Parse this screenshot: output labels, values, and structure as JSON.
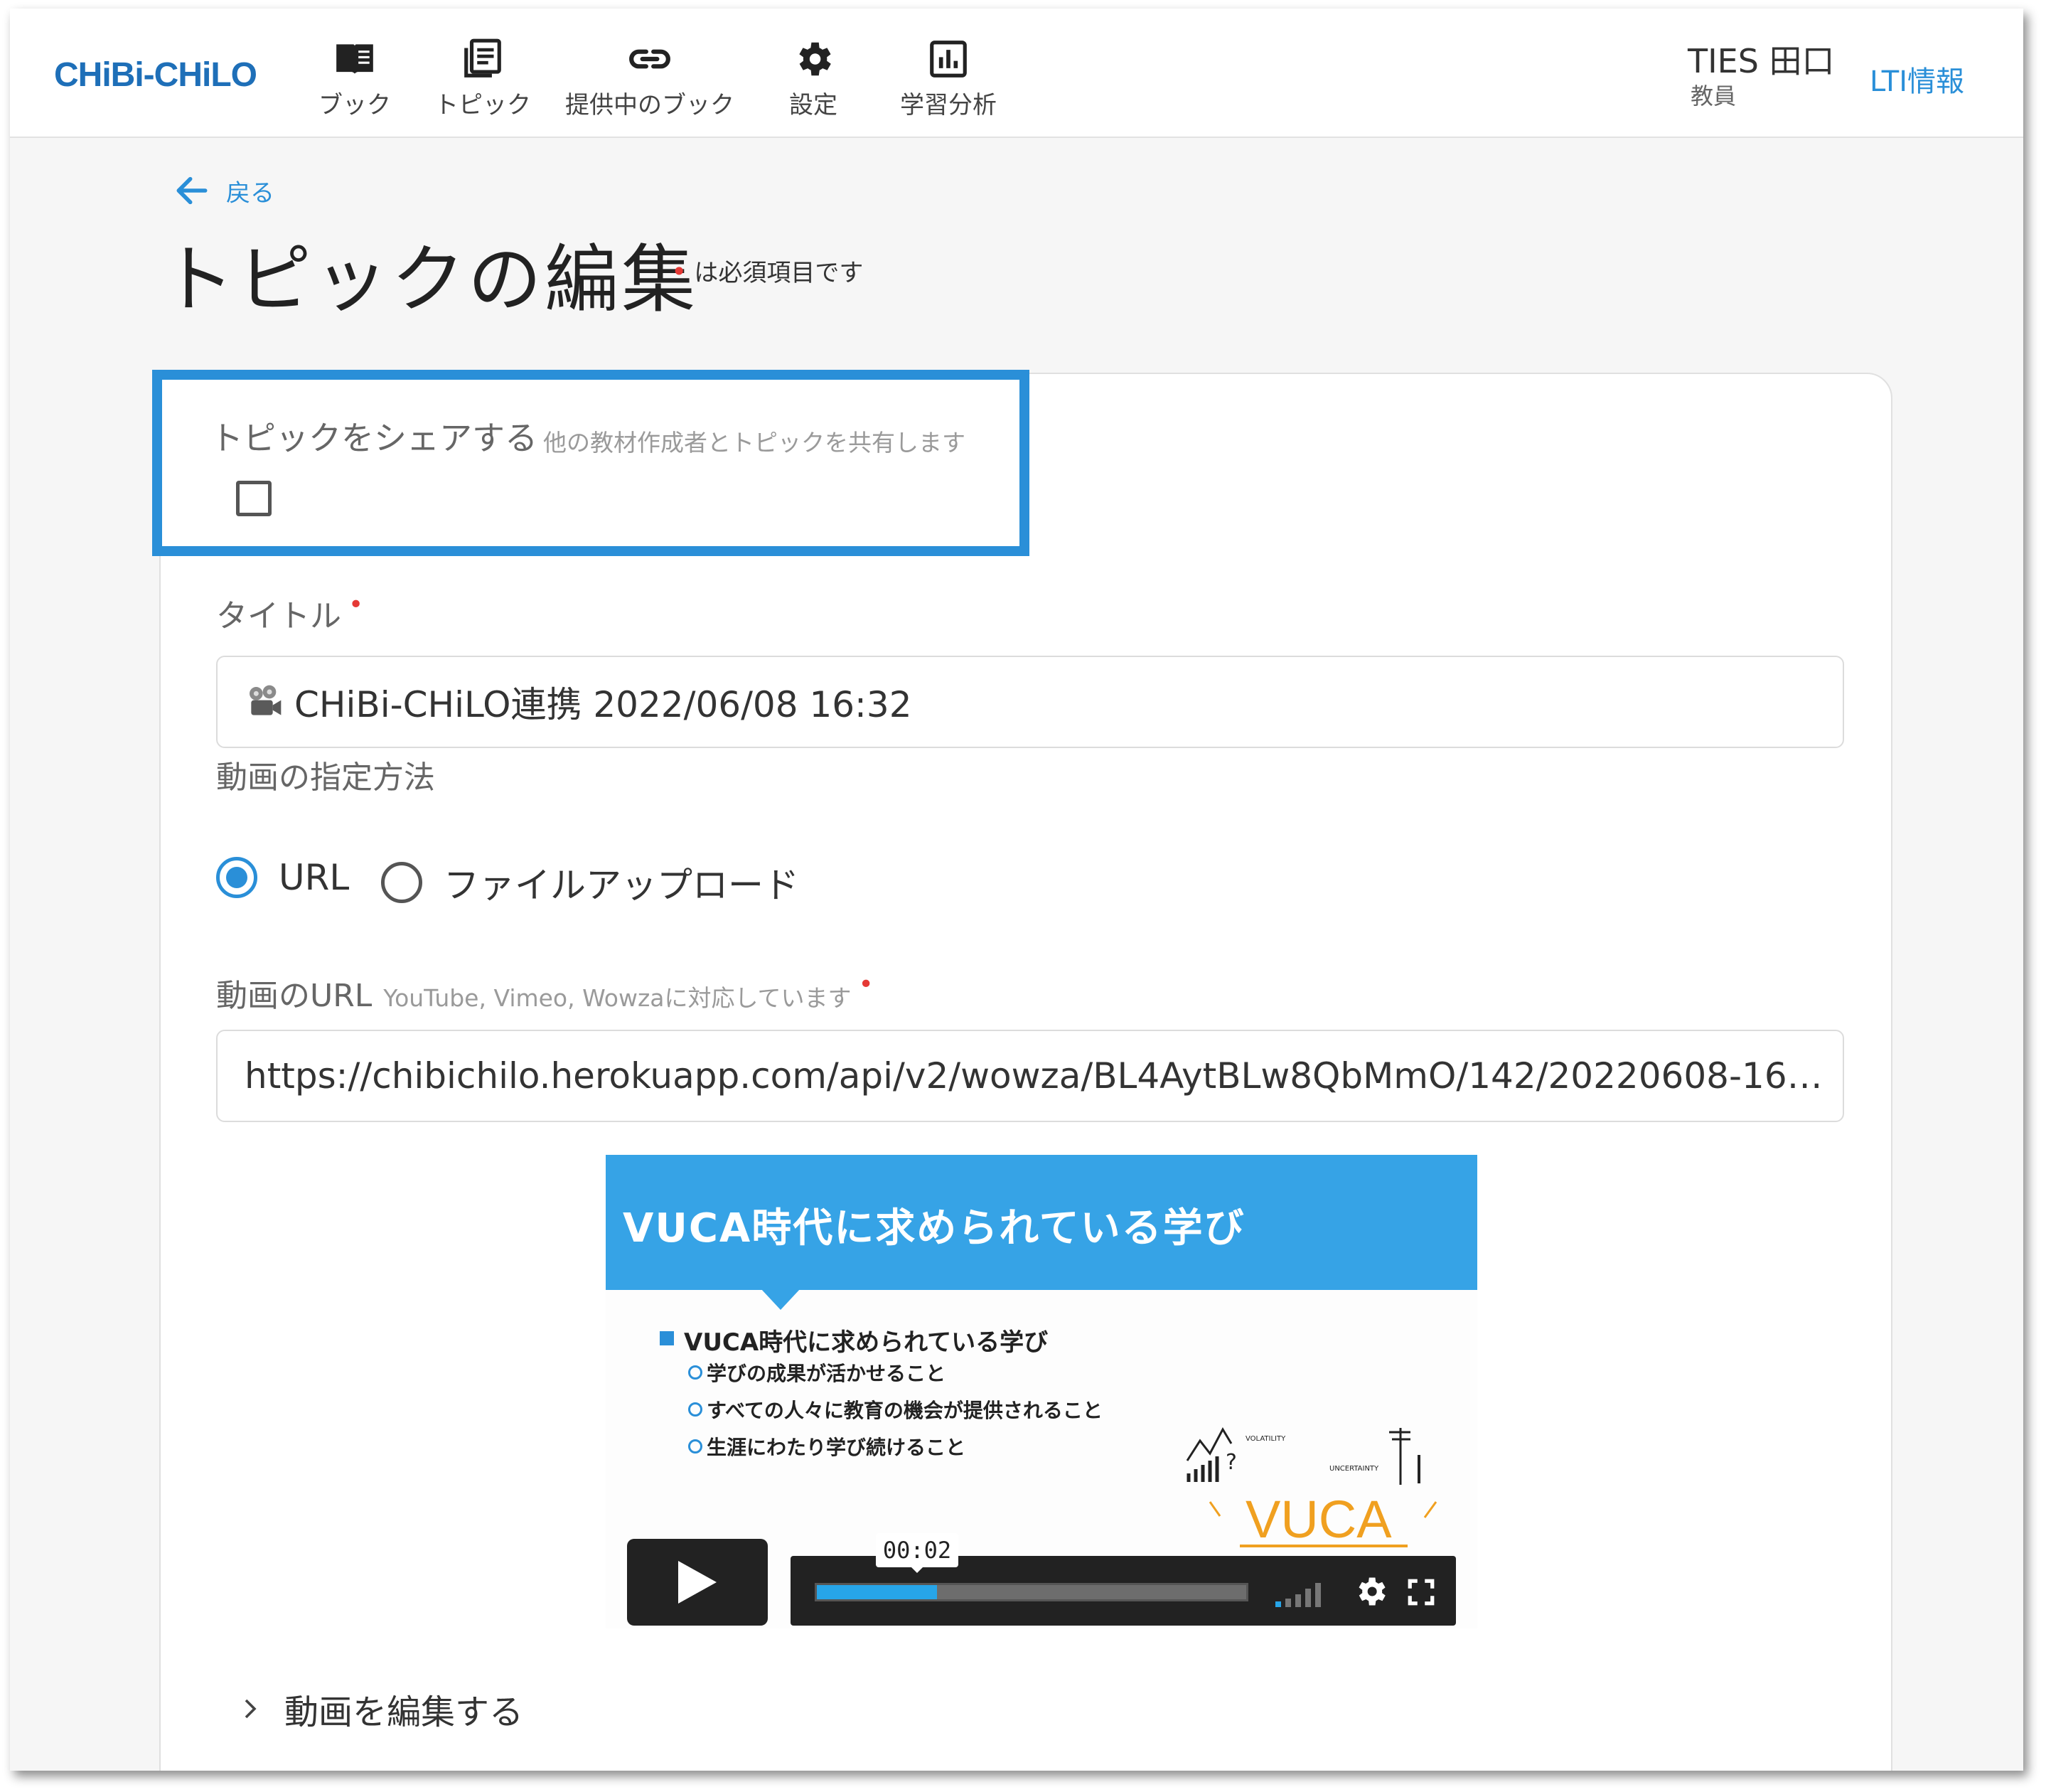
{
  "header": {
    "logo": "CHiBi-CHiLO",
    "nav": [
      {
        "label": "ブック",
        "icon": "book-icon"
      },
      {
        "label": "トピック",
        "icon": "topic-list-icon"
      },
      {
        "label": "提供中のブック",
        "icon": "link-icon"
      },
      {
        "label": "設定",
        "icon": "gear-icon"
      },
      {
        "label": "学習分析",
        "icon": "analytics-icon"
      }
    ],
    "user_name": "TIES 田口",
    "user_role": "教員",
    "lti_link": "LTI情報"
  },
  "page": {
    "back_label": "戻る",
    "title": "トピックの編集",
    "required_note": "は必須項目です"
  },
  "form": {
    "share": {
      "label": "トピックをシェアする",
      "hint": "他の教材作成者とトピックを共有します",
      "checked": false
    },
    "title": {
      "label": "タイトル",
      "value": "CHiBi-CHiLO連携 2022/06/08 16:32"
    },
    "video_method": {
      "label": "動画の指定方法",
      "options": [
        {
          "label": "URL",
          "selected": true
        },
        {
          "label": "ファイルアップロード",
          "selected": false
        }
      ]
    },
    "video_url": {
      "label": "動画のURL",
      "hint": "YouTube, Vimeo, Wowzaに対応しています",
      "value": "https://chibichilo.herokuapp.com/api/v2/wowza/BL4AytBLw8QbMmO/142/20220608-16…"
    },
    "edit_video_label": "動画を編集する"
  },
  "video_player": {
    "slide": {
      "heading": "VUCA時代に求められている学び",
      "bullet": "VUCA時代に求められている学び",
      "sub_bullets": [
        "学びの成果が活かせること",
        "すべての人々に教育の機会が提供されること",
        "生涯にわたり学び続けること"
      ],
      "graphic_word": "VUCA",
      "graphic_small_labels": [
        "VOLATILITY",
        "UNCERTAINTY"
      ]
    },
    "current_time": "00:02",
    "progress": 0.28,
    "accent_color": "#27a5e8"
  },
  "colors": {
    "brand": "#1e6fb8",
    "link": "#2a8fd8",
    "required": "#e53935",
    "highlight_border": "#2a8fd8",
    "slide_banner": "#36a3e6"
  }
}
